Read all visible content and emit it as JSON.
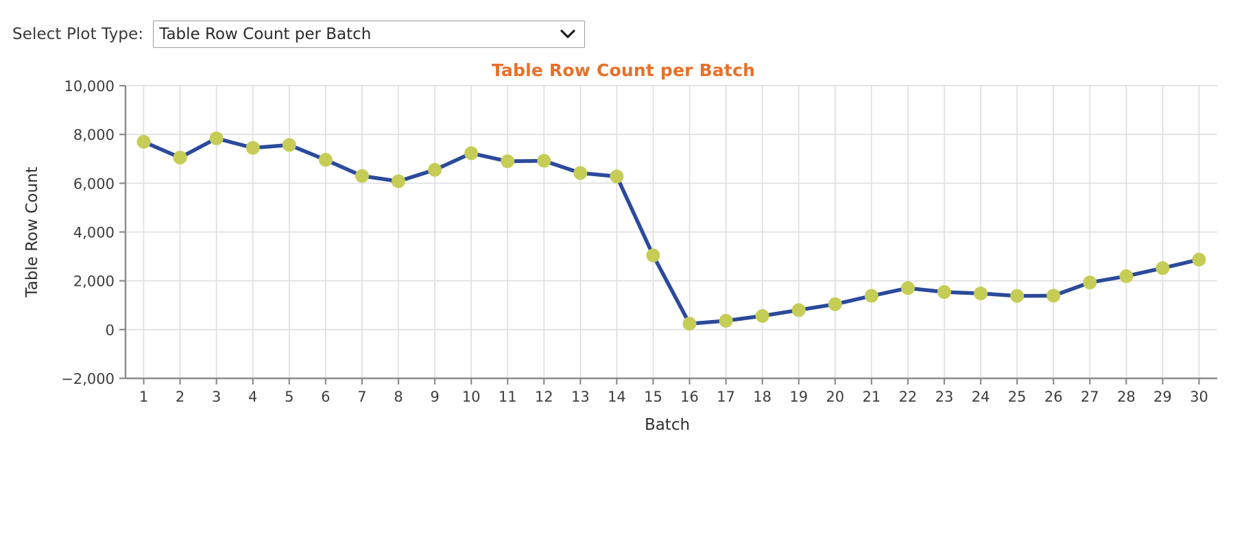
{
  "controls": {
    "label": "Select Plot Type:",
    "selected": "Table Row Count per Batch",
    "options": [
      "Table Row Count per Batch"
    ],
    "chevron_icon": "chevron-down-icon"
  },
  "colors": {
    "title": "#e8702a",
    "line": "#2b4a9b",
    "marker_fill": "#c5cd56",
    "grid": "#dedede",
    "axis": "#8a8a8a",
    "text": "#3d3d3d",
    "background": "#ffffff"
  },
  "chart_data": {
    "type": "line",
    "title": "Table Row Count per Batch",
    "xlabel": "Batch",
    "ylabel": "Table Row Count",
    "xlim": [
      0.5,
      30.5
    ],
    "ylim": [
      -2000,
      10000
    ],
    "yticks": [
      -2000,
      0,
      2000,
      4000,
      6000,
      8000,
      10000
    ],
    "ytick_labels": [
      "−2,000",
      "0",
      "2,000",
      "4,000",
      "6,000",
      "8,000",
      "10,000"
    ],
    "grid": true,
    "legend": null,
    "categories": [
      1,
      2,
      3,
      4,
      5,
      6,
      7,
      8,
      9,
      10,
      11,
      12,
      13,
      14,
      15,
      16,
      17,
      18,
      19,
      20,
      21,
      22,
      23,
      24,
      25,
      26,
      27,
      28,
      29,
      30
    ],
    "xtick_labels": [
      "1",
      "2",
      "3",
      "4",
      "5",
      "6",
      "7",
      "8",
      "9",
      "10",
      "11",
      "12",
      "13",
      "14",
      "15",
      "16",
      "17",
      "18",
      "19",
      "20",
      "21",
      "22",
      "23",
      "24",
      "25",
      "26",
      "27",
      "28",
      "29",
      "30"
    ],
    "values": [
      7700,
      7050,
      7840,
      7450,
      7570,
      6960,
      6300,
      6080,
      6550,
      7230,
      6900,
      6920,
      6420,
      6280,
      3040,
      240,
      360,
      560,
      800,
      1040,
      1380,
      1700,
      1540,
      1480,
      1380,
      1390,
      1930,
      2190,
      2520,
      2870
    ],
    "series": [
      {
        "name": "Table Row Count",
        "values": [
          7700,
          7050,
          7840,
          7450,
          7570,
          6960,
          6300,
          6080,
          6550,
          7230,
          6900,
          6920,
          6420,
          6280,
          3040,
          240,
          360,
          560,
          800,
          1040,
          1380,
          1700,
          1540,
          1480,
          1380,
          1390,
          1930,
          2190,
          2520,
          2870
        ]
      }
    ]
  }
}
